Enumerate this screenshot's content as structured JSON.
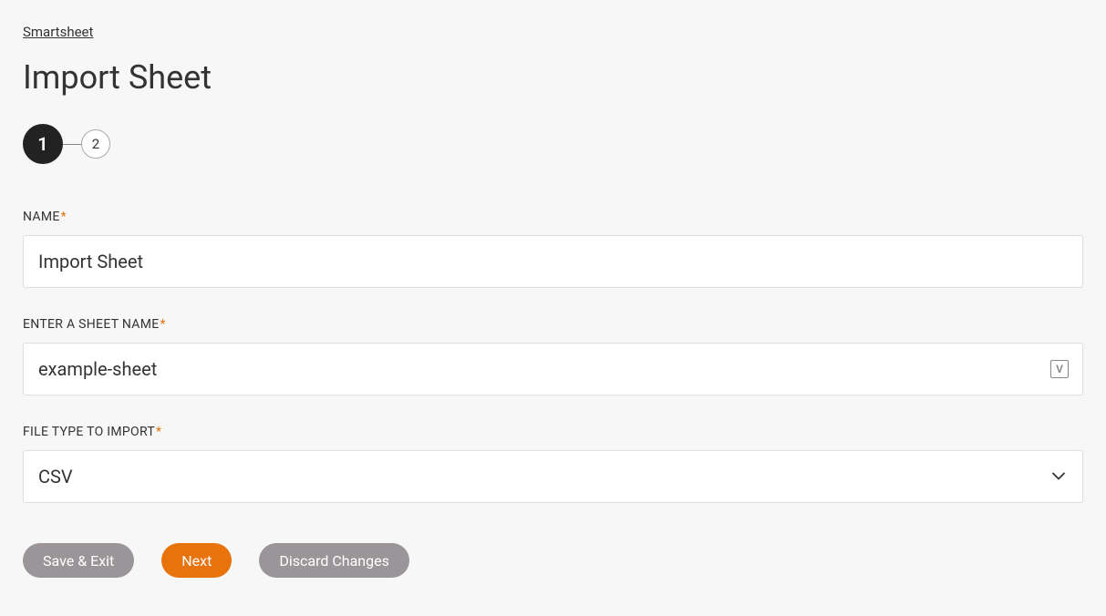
{
  "breadcrumb": {
    "label": "Smartsheet"
  },
  "page": {
    "title": "Import Sheet"
  },
  "stepper": {
    "step1": "1",
    "step2": "2"
  },
  "fields": {
    "name": {
      "label": "NAME",
      "value": "Import Sheet"
    },
    "sheetName": {
      "label": "ENTER A SHEET NAME",
      "value": "example-sheet",
      "variableIcon": "V"
    },
    "fileType": {
      "label": "FILE TYPE TO IMPORT",
      "value": "CSV"
    }
  },
  "buttons": {
    "saveExit": "Save & Exit",
    "next": "Next",
    "discard": "Discard Changes"
  }
}
